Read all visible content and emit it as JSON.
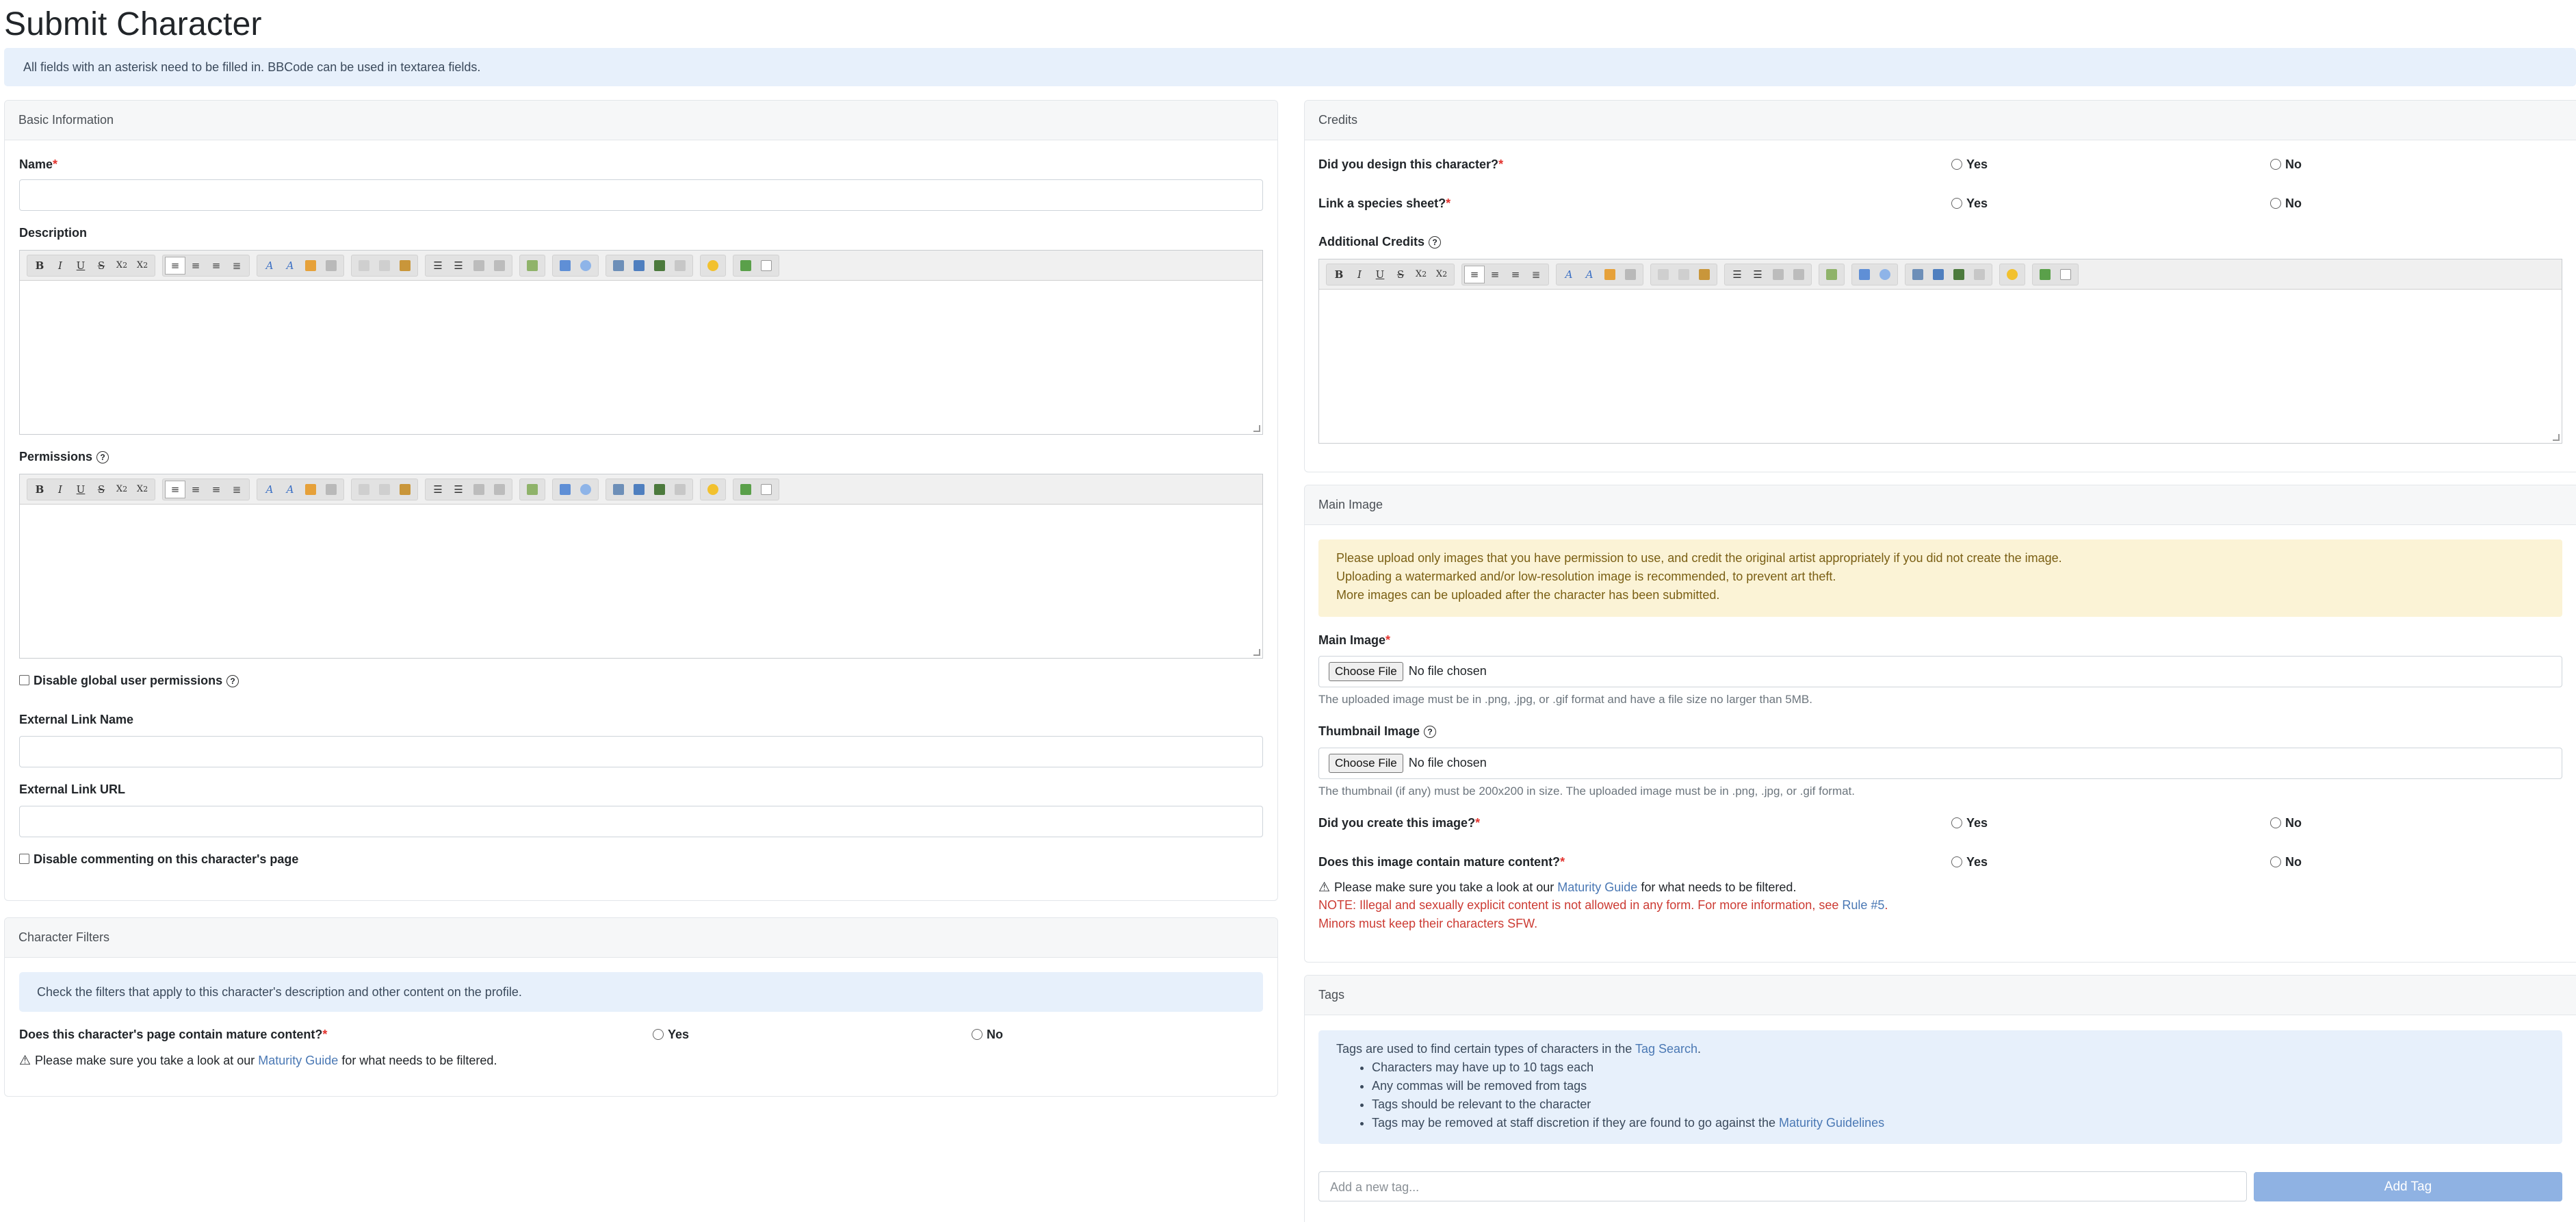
{
  "page": {
    "title": "Submit Character"
  },
  "notice": "All fields with an asterisk need to be filled in. BBCode can be used in textarea fields.",
  "basic": {
    "header": "Basic Information",
    "name_label": "Name",
    "description_label": "Description",
    "permissions_label": "Permissions",
    "disable_global_label": "Disable global user permissions",
    "external_name_label": "External Link Name",
    "external_url_label": "External Link URL",
    "disable_comments_label": "Disable commenting on this character's page"
  },
  "filters": {
    "header": "Character Filters",
    "info": "Check the filters that apply to this character's description and other content on the profile.",
    "mature_question": "Does this character's page contain mature content?",
    "yes": "Yes",
    "no": "No",
    "note_pre": "Please make sure you take a look at our",
    "note_link": "Maturity Guide",
    "note_post": "for what needs to be filtered."
  },
  "credits": {
    "header": "Credits",
    "design_question": "Did you design this character?",
    "species_question": "Link a species sheet?",
    "additional_label": "Additional Credits",
    "yes": "Yes",
    "no": "No"
  },
  "main_image": {
    "header": "Main Image",
    "warning_lines": [
      "Please upload only images that you have permission to use, and credit the original artist appropriately if you did not create the image.",
      "Uploading a watermarked and/or low-resolution image is recommended, to prevent art theft.",
      "More images can be uploaded after the character has been submitted."
    ],
    "main_label": "Main Image",
    "choose_file": "Choose File",
    "no_file": "No file chosen",
    "main_help": "The uploaded image must be in .png, .jpg, or .gif format and have a file size no larger than 5MB.",
    "thumb_label": "Thumbnail Image",
    "thumb_help": "The thumbnail (if any) must be 200x200 in size. The uploaded image must be in .png, .jpg, or .gif format.",
    "create_question": "Did you create this image?",
    "mature_question": "Does this image contain mature content?",
    "yes": "Yes",
    "no": "No",
    "note_pre": "Please make sure you take a look at our",
    "note_link": "Maturity Guide",
    "note_post": "for what needs to be filtered.",
    "danger_pre": "NOTE: Illegal and sexually explicit content is not allowed in any form. For more information, see",
    "danger_link": "Rule #5",
    "danger_post": ".",
    "danger_line2": "Minors must keep their characters SFW."
  },
  "tags": {
    "header": "Tags",
    "intro_pre": "Tags are used to find certain types of characters in the",
    "intro_link": "Tag Search",
    "intro_post": ".",
    "rules": [
      "Characters may have up to 10 tags each",
      "Any commas will be removed from tags",
      "Tags should be relevant to the character"
    ],
    "rule4_pre": "Tags may be removed at staff discretion if they are found to go against the",
    "rule4_link": "Maturity Guidelines",
    "input_placeholder": "Add a new tag...",
    "add_button": "Add Tag"
  },
  "toolbar_icons": [
    "bold",
    "italic",
    "underline",
    "strikethrough",
    "subscript",
    "superscript",
    "align-left",
    "align-center",
    "align-right",
    "justify",
    "font",
    "font-size",
    "text-color",
    "remove-format",
    "cut",
    "copy",
    "paste",
    "bullet-list",
    "numbered-list",
    "outdent",
    "indent",
    "horizontal-rule",
    "image",
    "quote",
    "table",
    "link",
    "email",
    "unlink",
    "emoticon",
    "source",
    "maximize"
  ]
}
